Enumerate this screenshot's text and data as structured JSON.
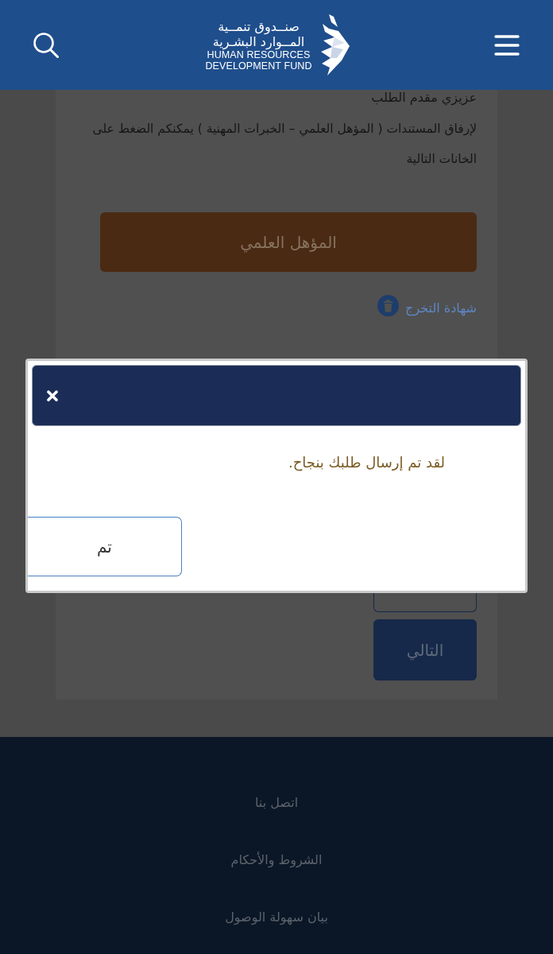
{
  "header": {
    "logo": {
      "arabic_lines": [
        "صنــدوق تنمــية",
        "المــوارد البشـرية"
      ],
      "english_lines": [
        "HUMAN RESOURCES",
        "DEVELOPMENT FUND"
      ]
    }
  },
  "form": {
    "greeting": "عزيزي مقدم الطلب",
    "instructions": "لإرفاق المستندات ( المؤهل العلمي – الخبرات المهنية ) يمكنكم الضغط على الخانات التالية",
    "section_button": "المؤهل العلمي",
    "attachments": [
      {
        "name": "شهادة التخرج"
      }
    ],
    "next_button": "التالي"
  },
  "dialog": {
    "message": "لقد تم إرسال طلبك بنجاح.",
    "confirm_button": "تم"
  },
  "footer": {
    "links": [
      "اتصل بنا",
      "الشروط والأحكام",
      "بيان سهولة الوصول"
    ]
  }
}
